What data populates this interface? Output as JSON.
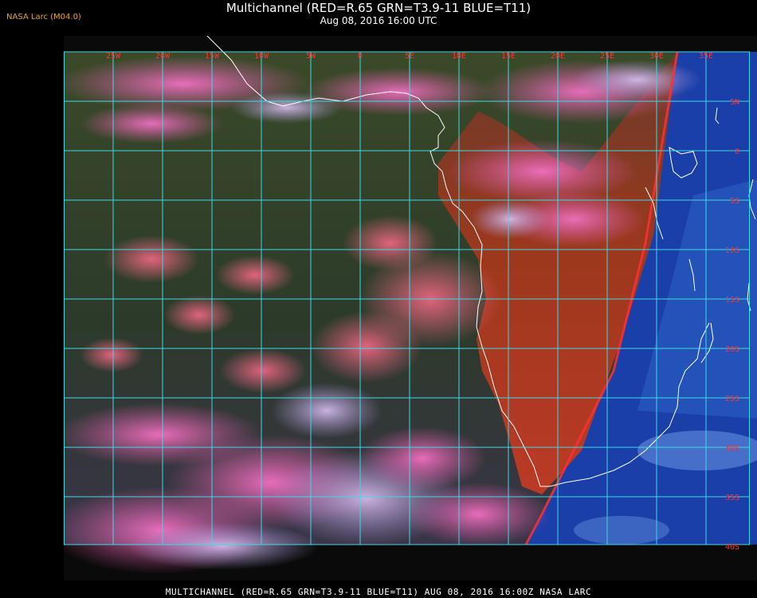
{
  "header": {
    "title": "Multichannel (RED=R.65 GRN=T3.9-11 BLUE=T11)",
    "datetime": "Aug 08, 2016 16:00 UTC",
    "credit": "NASA Larc (M04.0)"
  },
  "footer": {
    "caption": "MULTICHANNEL (RED=R.65 GRN=T3.9-11 BLUE=T11) AUG 08, 2016 16:00Z  NASA LARC"
  },
  "map": {
    "lon_labels": [
      "25W",
      "20W",
      "15W",
      "10W",
      "5W",
      "0",
      "5E",
      "10E",
      "15E",
      "20E",
      "25E",
      "30E",
      "35E"
    ],
    "lat_labels": [
      "5N",
      "0",
      "5S",
      "10S",
      "15S",
      "20S",
      "25S",
      "30S",
      "35S",
      "40S"
    ],
    "colors": {
      "grid": "#3fd8e6",
      "coastline": "#ffffff",
      "labels": "#ff3333",
      "ocean": "#2a3a22",
      "land": "#b03318",
      "clouds": "#ee5aa8",
      "east_side": "#1b3fa8"
    }
  }
}
